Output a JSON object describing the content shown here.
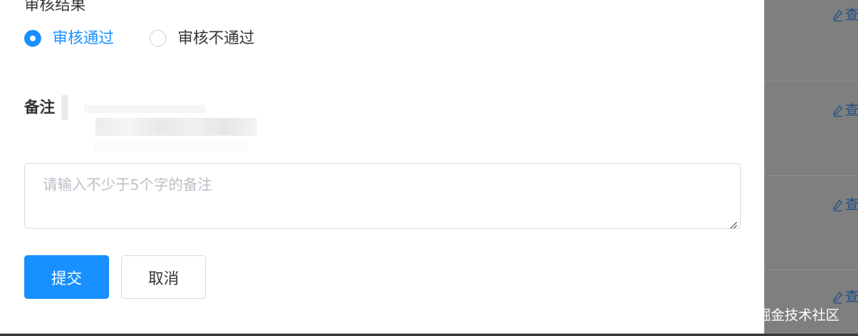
{
  "review": {
    "section_title": "审核结果",
    "options": [
      {
        "label": "审核通过",
        "selected": true
      },
      {
        "label": "审核不通过",
        "selected": false
      }
    ]
  },
  "remark": {
    "label": "备注",
    "placeholder": "请输入不少于5个字的备注",
    "value": ""
  },
  "buttons": {
    "submit": "提交",
    "cancel": "取消"
  },
  "background_table": {
    "rows": [
      {
        "action_label": "查"
      },
      {
        "action_label": "查"
      },
      {
        "action_label": "查"
      },
      {
        "action_label": "查"
      }
    ]
  },
  "watermark": "@稀土掘金技术社区",
  "colors": {
    "primary": "#1890ff",
    "text": "#333333",
    "placeholder": "#bcbfc6",
    "overlay": "#7f7f7f",
    "link": "#1f4f86"
  },
  "icons": {
    "row_action": "edit-icon",
    "textarea_corner": "resize-handle-icon"
  }
}
